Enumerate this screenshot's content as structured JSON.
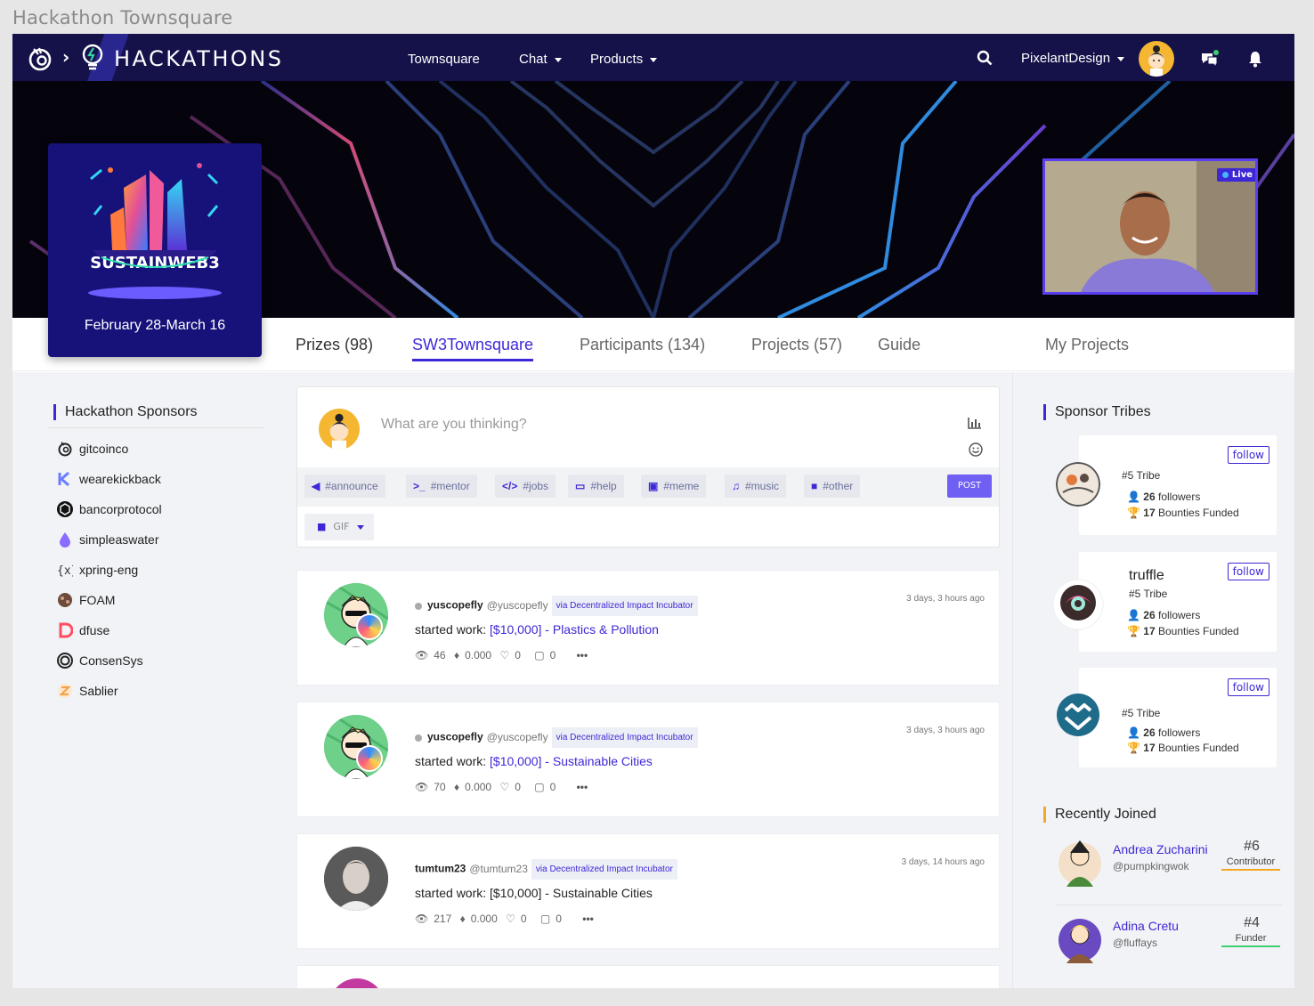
{
  "window_title": "Hackathon Townsquare",
  "nav": {
    "brand": "HACKATHONS",
    "links": [
      {
        "label": "Townsquare"
      },
      {
        "label": "Chat"
      },
      {
        "label": "Products"
      }
    ],
    "username": "PixelantDesign"
  },
  "hackathon": {
    "logo_text": "SUSTAINWEB3",
    "dates": "February 28-March 16",
    "live_label": "Live"
  },
  "tabs": [
    {
      "label": "Prizes (98)"
    },
    {
      "label": "SW3Townsquare",
      "active": true
    },
    {
      "label": "Participants (134)"
    },
    {
      "label": "Projects (57)"
    },
    {
      "label": "Guide"
    },
    {
      "label": "My Projects"
    }
  ],
  "sponsors": {
    "title": "Hackathon Sponsors",
    "items": [
      {
        "name": "gitcoinco",
        "icon": "gitcoin-icon",
        "color": "#222222"
      },
      {
        "name": "wearekickback",
        "icon": "kickback-icon",
        "color": "#6b7cff"
      },
      {
        "name": "bancorprotocol",
        "icon": "bancor-icon",
        "color": "#111111"
      },
      {
        "name": "simpleaswater",
        "icon": "simpleaswater-icon",
        "color": "#8a6cff"
      },
      {
        "name": "xpring-eng",
        "icon": "xpring-icon",
        "color": "#333333"
      },
      {
        "name": "FOAM",
        "icon": "foam-icon",
        "color": "#6e4b3a"
      },
      {
        "name": "dfuse",
        "icon": "dfuse-icon",
        "color": "#ff4d5e"
      },
      {
        "name": "ConsenSys",
        "icon": "consensys-icon",
        "color": "#222222"
      },
      {
        "name": "Sablier",
        "icon": "sablier-icon",
        "color": "#f4a24b"
      }
    ]
  },
  "composer": {
    "placeholder": "What are you thinking?",
    "tags": [
      "#announce",
      "#mentor",
      "#jobs",
      "#help",
      "#meme",
      "#music",
      "#other"
    ],
    "post_label": "POST",
    "gif_label": "GIF"
  },
  "feed": [
    {
      "name": "yuscopefly",
      "handle": "@yuscopefly",
      "via": "via Decentralized Impact Incubator",
      "time": "3 days, 3 hours ago",
      "action": "started work:",
      "link": "[$10,000] - Plastics & Pollution",
      "views": "46",
      "eth": "0.000",
      "likes": "0",
      "comments": "0"
    },
    {
      "name": "yuscopefly",
      "handle": "@yuscopefly",
      "via": "via Decentralized Impact Incubator",
      "time": "3 days, 3 hours ago",
      "action": "started work:",
      "link": "[$10,000] - Sustainable Cities",
      "views": "70",
      "eth": "0.000",
      "likes": "0",
      "comments": "0"
    },
    {
      "name": "tumtum23",
      "handle": "@tumtum23",
      "via": "via Decentralized Impact Incubator",
      "time": "3 days, 14 hours ago",
      "action": "started work: [$10,000] - Sustainable Cities",
      "link": "",
      "views": "217",
      "eth": "0.000",
      "likes": "0",
      "comments": "0"
    }
  ],
  "sponsor_tribes": {
    "title": "Sponsor Tribes",
    "follow_label": "follow",
    "items": [
      {
        "name": "",
        "rank": "#5 Tribe",
        "followers": "26",
        "followers_label": "followers",
        "bounties": "17",
        "bounties_label": "Bounties Funded"
      },
      {
        "name": "truffle",
        "rank": "#5 Tribe",
        "followers": "26",
        "followers_label": "followers",
        "bounties": "17",
        "bounties_label": "Bounties Funded"
      },
      {
        "name": "",
        "rank": "#5 Tribe",
        "followers": "26",
        "followers_label": "followers",
        "bounties": "17",
        "bounties_label": "Bounties Funded"
      }
    ]
  },
  "recently_joined": {
    "title": "Recently Joined",
    "items": [
      {
        "name": "Andrea Zucharini",
        "handle": "@pumpkingwok",
        "rank": "#6",
        "role": "Contributor",
        "color": "#f5a623"
      },
      {
        "name": "Adina Cretu",
        "handle": "@fluffays",
        "rank": "#4",
        "role": "Funder",
        "color": "#3ecf6e"
      }
    ]
  },
  "colors": {
    "accent": "#3d28d6",
    "nav_bg": "#15124a",
    "card_bg": "#16127a"
  }
}
